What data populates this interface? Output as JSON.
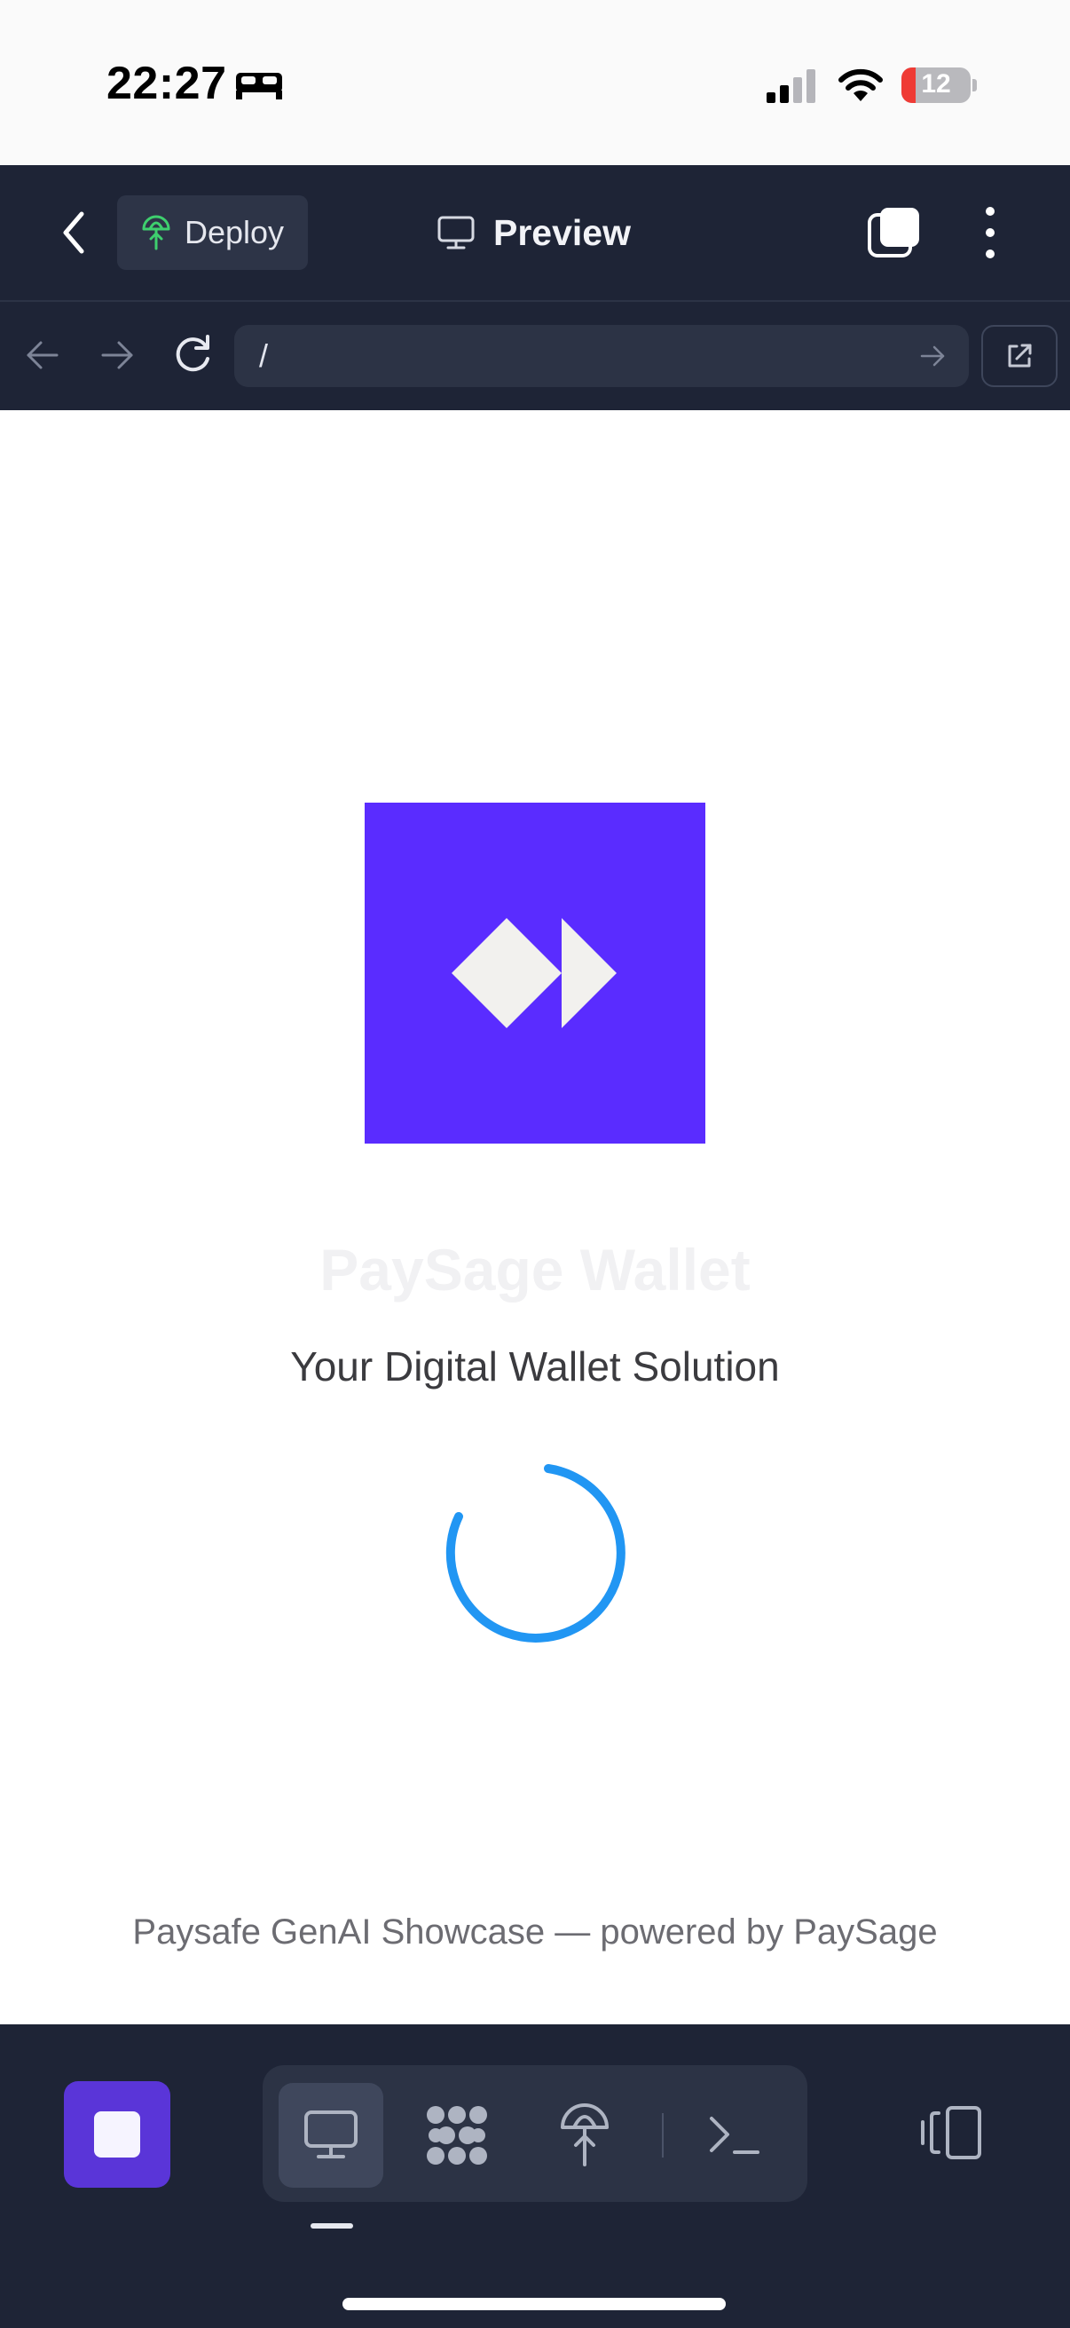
{
  "status_bar": {
    "time": "22:27",
    "battery_level": "12",
    "icons": [
      "bed-icon",
      "cellular-signal-icon",
      "wifi-icon",
      "battery-icon"
    ]
  },
  "header": {
    "deploy_label": "Deploy",
    "title": "Preview",
    "icons": [
      "chevron-left-icon",
      "deploy-icon",
      "monitor-icon",
      "tabs-icon",
      "more-vertical-icon"
    ]
  },
  "browser": {
    "url": "/",
    "icons": [
      "arrow-left-icon",
      "arrow-right-icon",
      "reload-icon",
      "go-arrow-icon",
      "external-link-icon"
    ]
  },
  "app": {
    "name": "PaySage Wallet",
    "tagline": "Your Digital Wallet Solution",
    "footer": "Paysafe GenAI Showcase — powered by PaySage",
    "brand_color": "#5a2cff",
    "spinner_color": "#2196f3"
  },
  "dock": {
    "tools": [
      "preview-tool",
      "workflows-tool",
      "deploy-tool",
      "console-tool"
    ],
    "active_tool": "preview-tool",
    "icons": [
      "stop-icon",
      "monitor-icon",
      "nodes-icon",
      "deploy-icon",
      "terminal-icon",
      "device-toggle-icon"
    ]
  }
}
